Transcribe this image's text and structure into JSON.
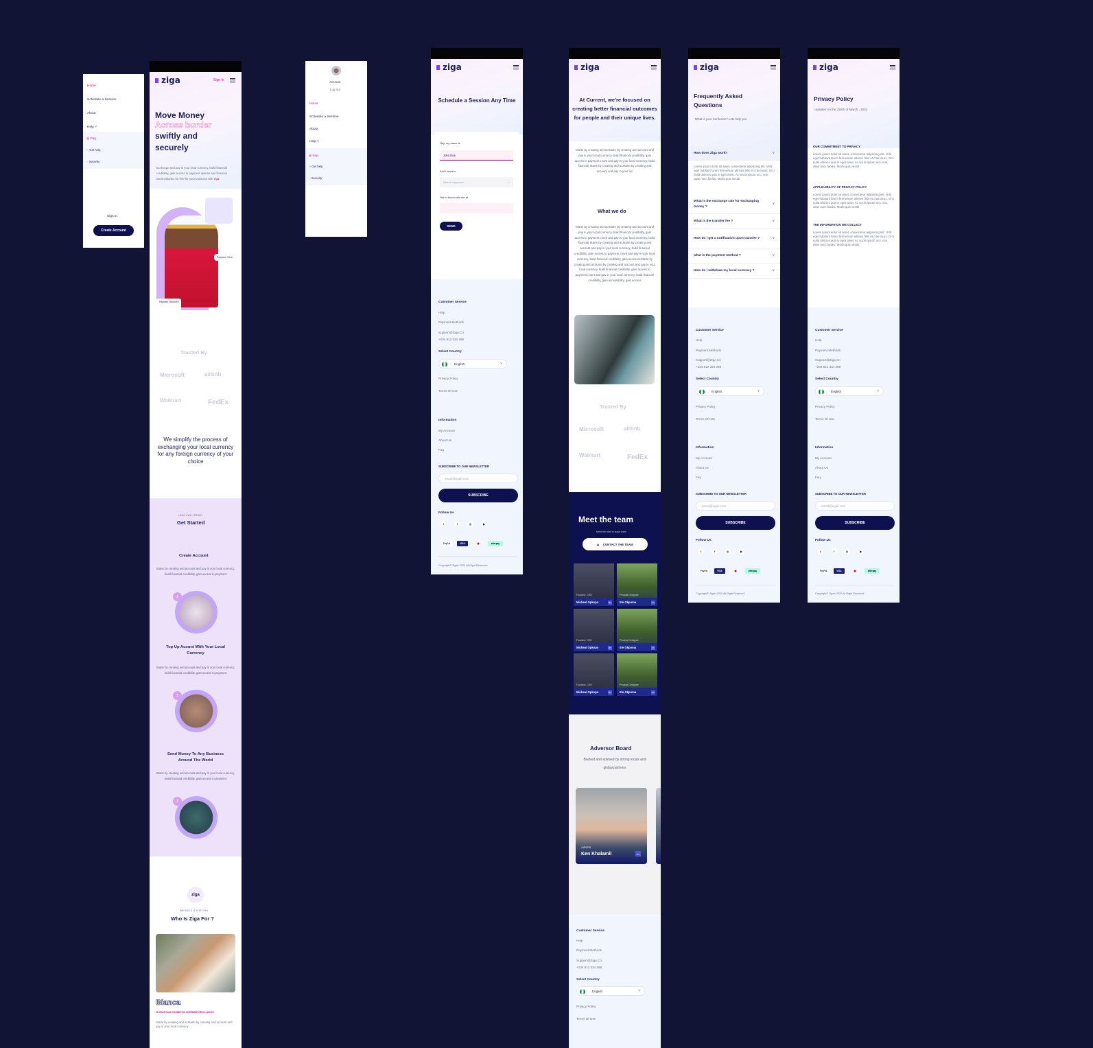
{
  "brand": {
    "name": "ziga",
    "accent": "#e2009e",
    "navy": "#0d1150",
    "background": "#121435"
  },
  "menu1": {
    "items": [
      "Home",
      "Schedule a Session",
      "About",
      "Help"
    ],
    "sub": [
      "Faq",
      "Get help",
      "Security"
    ],
    "sign_in": "Sign In",
    "create": "Create Account"
  },
  "home": {
    "sign_in": "Sign In",
    "h1": "Move Money",
    "h2": "Across border",
    "h3": "swiftly and",
    "h4": "securely",
    "desc": "Exchange and pay in your local currency, build financial credibility, gain access to payment options and financial intermediaries for free for your business with",
    "desc_link": "ziga",
    "badge1": "Payment Sent",
    "badge2": "Payment Recieved",
    "trusted": "Trusted By",
    "logos": [
      "Microsoft",
      "airbnb",
      "Walmart",
      "FedEx"
    ],
    "simplify": "We simplify the process of exchanging your local currency for any foreign currency of your choice",
    "how_small": "HOW CAN I START",
    "how_title": "Get Started",
    "steps": [
      {
        "title": "Create Account",
        "text": "Starte by creating and account and pay in your local currency, build financial credibility, gain access to payment",
        "n": "1"
      },
      {
        "title": "Top Up Acount With Your Local Currency",
        "text": "Starte by creating and account and pay in your local currency, build financial credibility, gain access to payment",
        "n": "2"
      },
      {
        "title": "Send Money To Any Business Around The World",
        "text": "Starte by creating and account and pay in your local currency, build financial credibility, gain access to payment",
        "n": "3"
      }
    ],
    "who_logo": "ziga",
    "who_small": "WE BUILD IT FOR YOU",
    "who_title": "Who Is Ziga For ?",
    "person": "Bianca",
    "person_role": "28 YEAR OLD COSMETICS DISTRIBUTOR IN LAGOS",
    "person_text": "Starte by creating and acStarte by creating and account and pay in your local currency"
  },
  "menu2": {
    "account": "Account",
    "logout": "Log out",
    "items": [
      "Home",
      "Schedule a Session",
      "About",
      "Help"
    ],
    "sub": [
      "Faq",
      "Get help",
      "Security"
    ]
  },
  "schedule": {
    "title": "Schedule a Session Any Time",
    "l1": "Hey, my name is",
    "v1": "John Doe",
    "l2": "And I want to",
    "v2": "Select dropdown",
    "l3": "Get in touch with me at",
    "send": "SEND"
  },
  "footer": {
    "cs": "Customer Service",
    "help": "Help",
    "pm": "Payment Methods",
    "email": "Support@Ziga.Co",
    "phone": "+234 812 334 288",
    "sc": "Select Country",
    "lang": "English",
    "pp": "Privacy Policy",
    "tou": "Terms Of Use",
    "info": "Information",
    "acc": "My Account",
    "about": "About Us",
    "faq": "Faq",
    "news": "SUBSCRIBE TO OUR NEWSLETTER",
    "email_ph": "email@egail.com",
    "subscribe": "SUBSCRIBE",
    "follow": "Follow Us",
    "pays": [
      "PayPal",
      "VISA",
      "MC",
      "afterpay"
    ],
    "copy": "Copyright© Zigah 2022 All Right Reserved"
  },
  "about": {
    "title": "At Current, we're focused on creating better financial outcomes for people and their unique lives.",
    "p1": "Starte by creating and acStarte by creating and account and pay in your local currency, build financial credibility, gain access to payment count and pay in your local currency, build financial Starte by creating and acStarte by creating and account and pay in your loc",
    "what": "What we do",
    "p2": "Starte by creating and acStarte by creating and account and pay in your local currency, build financial credibility, gain access to payment count and pay in your local currency, build financial Starte by creating and acStarte by creating and account and pay in your local currency, build financial credibility, gain access to payment count and pay in your local currency, build financial credibility, gain accessacStarte by creating and acStarte by creating and account and pay in your local currency, build financial credibility, gain access to payment count and pay in your local currency, build financial credibility, gain accessibility, gain access",
    "trusted": "Trusted By",
    "team_title": "Meet the team",
    "team_sub": "Meet the best in class team",
    "contact": "CONTACT THE TEAM",
    "members": [
      {
        "name": "Micheal Opkopo",
        "role": "Founder, CEO"
      },
      {
        "name": "Ele Okpoma",
        "role": "Product Designer"
      },
      {
        "name": "Micheal Opkopo",
        "role": "Founder, CEO"
      },
      {
        "name": "Ele Okpoma",
        "role": "Product Designer"
      },
      {
        "name": "Micheal Opkopo",
        "role": "Founder, CEO"
      },
      {
        "name": "Ele Okpoma",
        "role": "Product Designer"
      }
    ],
    "board": "Adversor Board",
    "board_sub": "Backed and advised by strong locals and global partners",
    "adv_role": "Advisor",
    "adv_name": "Ken Khalamil"
  },
  "faq": {
    "title": "Frequently Asked Questions",
    "sub": "What is your Confusion? Lets help you",
    "q": [
      "How does Ziga work?",
      "What is the exchange rate for exchanging money ?",
      "What is the transfer fee ?",
      "How do i get a notification upon transfer ?",
      "what is the payment method ?",
      "How do i withdraw my local currency ?"
    ],
    "a": "Lorem ipsum dolor sit amet, consectetur adipiscing elit. Velit eget habitant lorem fermentum ultrices felis et cras lacus. Orci nulla ultricies quis in eget amet. Ac sociis ipsum orci, non, vitae nunc facilisi. Morbi quis vestib"
  },
  "privacy": {
    "title": "Privacy Policy",
    "updated": "Updated on the 22nth of March , 2022",
    "s1": "OUR COMMITMENT TO PRIVACY",
    "s2": "APPLICABILITY OF PRIVACY POLICY",
    "s3": "THE INFORMATION WE COLLECT",
    "body": "Lorem ipsum dolor sit amet, consectetur adipiscing elit. Velit eget habitant lorem fermentum ultrices felis et cras lacus. Orci nulla ultricies quis in eget amet. Ac sociis ipsum orci, non, vitae nunc facilisi. Morbi quis vestib"
  }
}
